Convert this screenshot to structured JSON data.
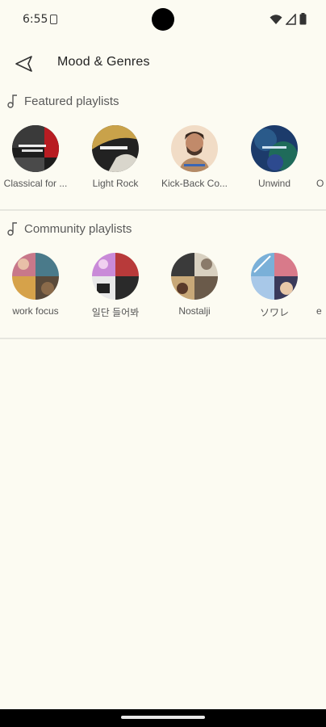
{
  "status_bar": {
    "time": "6:55"
  },
  "app_bar": {
    "title": "Mood & Genres"
  },
  "featured": {
    "title": "Featured playlists",
    "items": [
      {
        "label": "Classical for ..."
      },
      {
        "label": "Light Rock"
      },
      {
        "label": "Kick-Back Co..."
      },
      {
        "label": "Unwind"
      },
      {
        "label": "O"
      }
    ]
  },
  "community": {
    "title": "Community playlists",
    "items": [
      {
        "label": "work focus"
      },
      {
        "label": "일단 들어봐"
      },
      {
        "label": "Nostalji"
      },
      {
        "label": "ソワレ"
      },
      {
        "label": "e"
      }
    ]
  },
  "colors": {
    "background": "#fcfbf2",
    "divider": "#e6e6df",
    "text_primary": "#222222",
    "text_secondary": "#555555"
  }
}
